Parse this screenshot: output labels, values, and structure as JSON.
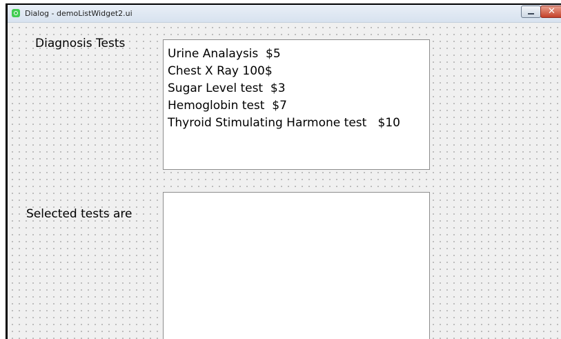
{
  "window": {
    "title": "Dialog - demoListWidget2.ui"
  },
  "labels": {
    "diagnosis": "Diagnosis Tests",
    "selected": "Selected tests are"
  },
  "diagnosis_list": {
    "items": [
      "Urine Analaysis  $5",
      "Chest X Ray 100$",
      "Sugar Level test  $3",
      "Hemoglobin test  $7",
      "Thyroid Stimulating Harmone test   $10"
    ]
  },
  "selected_list": {
    "items": []
  },
  "icons": {
    "app": "qt-logo-icon",
    "minimize": "minimize-icon",
    "close": "close-icon"
  },
  "colors": {
    "close_button": "#c4412a",
    "qt_green": "#41cd52"
  }
}
